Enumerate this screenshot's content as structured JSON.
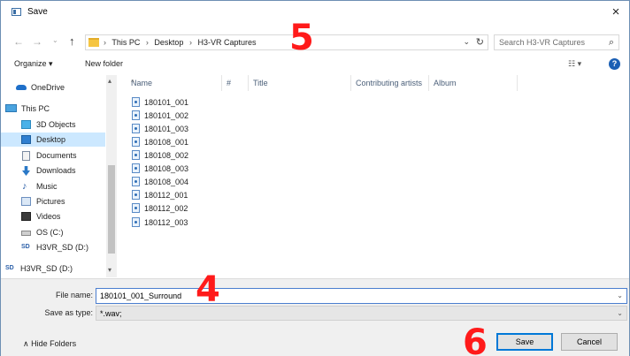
{
  "window": {
    "title": "Save",
    "close_glyph": "×"
  },
  "address": {
    "back_glyph": "←",
    "forward_glyph": "→",
    "recent_glyph": "⌄",
    "up_glyph": "↑",
    "crumbs": [
      "This PC",
      "Desktop",
      "H3-VR Captures"
    ],
    "sep": "›",
    "dropdown_glyph": "⌄",
    "refresh_glyph": "↻",
    "search_placeholder": "Search H3-VR Captures",
    "search_icon": "⌕"
  },
  "commandbar": {
    "organize_label": "Organize ▾",
    "new_folder_label": "New folder",
    "view_label": "☷ ▾",
    "help_label": "?"
  },
  "nav": {
    "items": [
      {
        "label": "OneDrive",
        "icon": "cloud-icon"
      },
      {
        "label": "This PC",
        "icon": "computer-icon"
      },
      {
        "label": "3D Objects",
        "icon": "cube-icon"
      },
      {
        "label": "Desktop",
        "icon": "desktop-icon"
      },
      {
        "label": "Documents",
        "icon": "document-icon"
      },
      {
        "label": "Downloads",
        "icon": "download-icon"
      },
      {
        "label": "Music",
        "icon": "music-icon"
      },
      {
        "label": "Pictures",
        "icon": "pictures-icon"
      },
      {
        "label": "Videos",
        "icon": "video-icon"
      },
      {
        "label": "OS (C:)",
        "icon": "drive-icon"
      },
      {
        "label": "H3VR_SD (D:)",
        "icon": "sd-card-icon"
      },
      {
        "label": "H3VR_SD (D:)",
        "icon": "sd-card-icon"
      }
    ],
    "scroll_up": "▴",
    "scroll_down": "▾"
  },
  "columns": [
    "Name",
    "#",
    "Title",
    "Contributing artists",
    "Album"
  ],
  "sort_glyph": "^",
  "files": [
    "180101_001",
    "180101_002",
    "180101_003",
    "180108_001",
    "180108_002",
    "180108_003",
    "180108_004",
    "180112_001",
    "180112_002",
    "180112_003"
  ],
  "form": {
    "filename_label": "File name:",
    "filename_value": "180101_001_Surround",
    "savetype_label": "Save as type:",
    "savetype_value": "*.wav;",
    "dropdown_glyph": "⌄"
  },
  "footer": {
    "hide_folders_label": "∧  Hide Folders",
    "save_label": "Save",
    "cancel_label": "Cancel"
  },
  "annotations": {
    "step4": "4",
    "step5": "5",
    "step6": "6"
  },
  "colors": {
    "annotation": "#ff1a1a",
    "selection": "#cce8ff",
    "accent": "#0078d7"
  }
}
